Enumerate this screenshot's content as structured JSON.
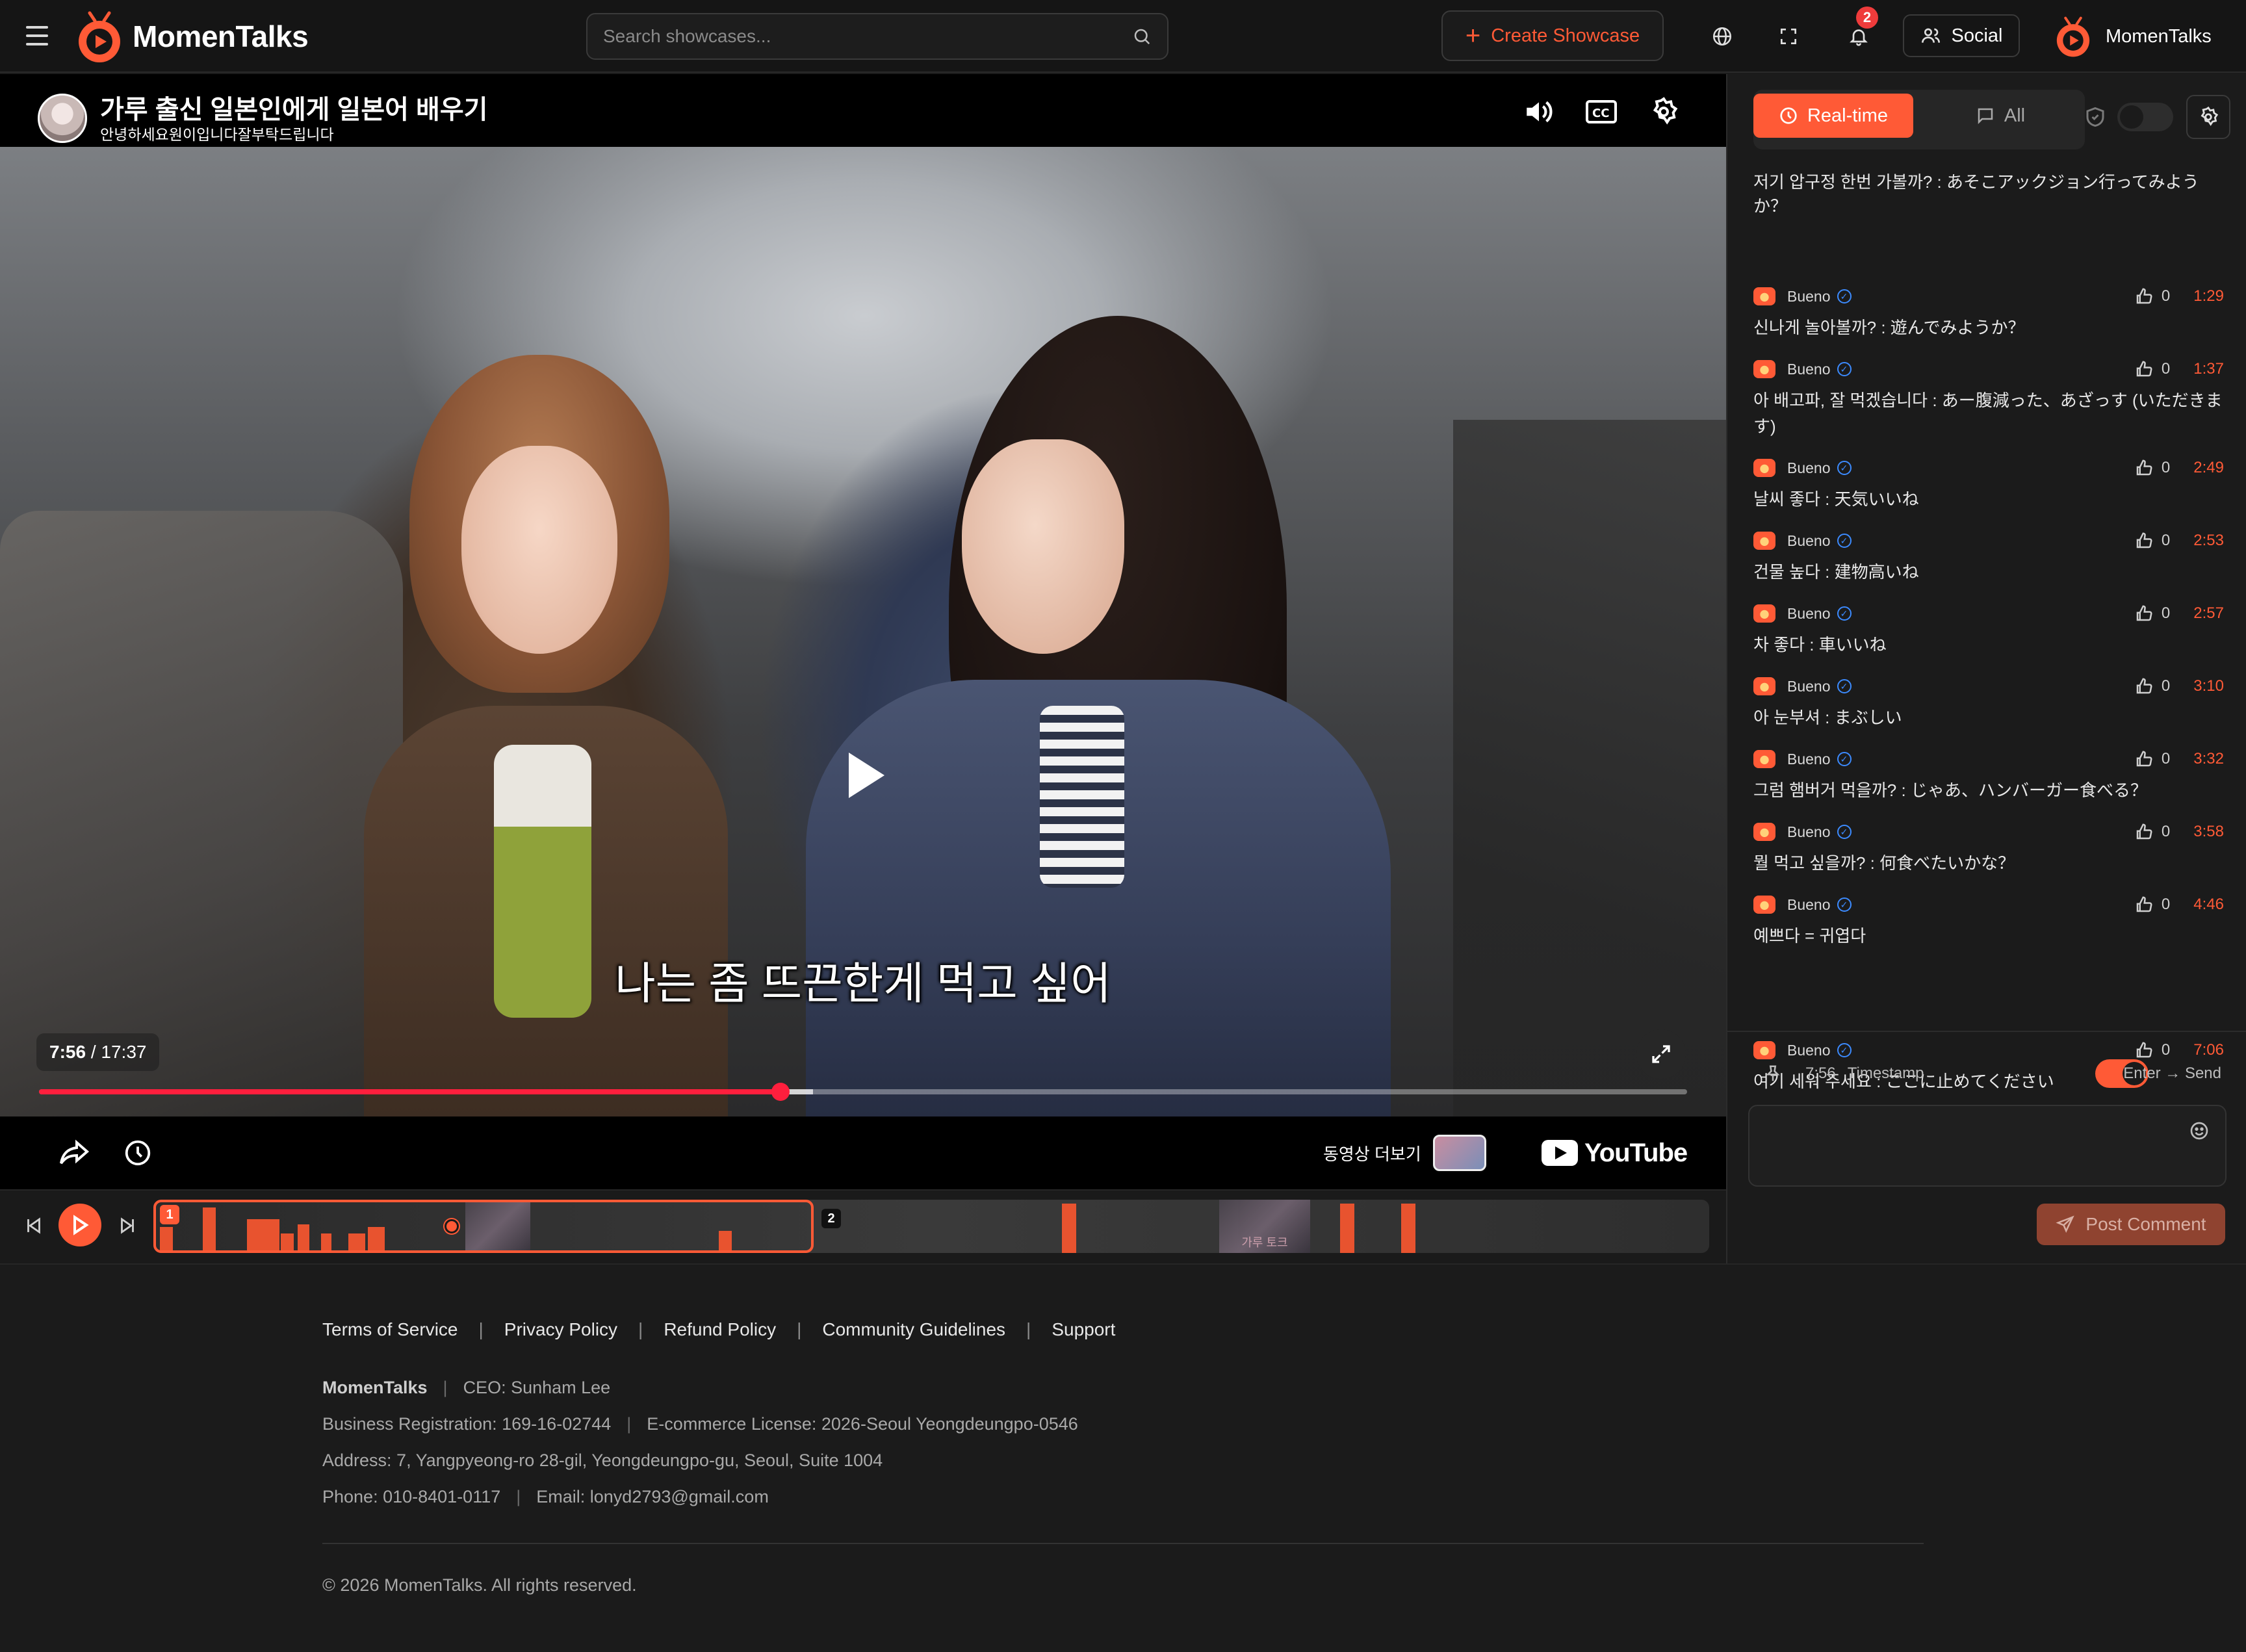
{
  "app": {
    "name": "MomenTalks",
    "brand_color": "#ff5a36"
  },
  "topbar": {
    "search_placeholder": "Search showcases...",
    "create_label": "Create Showcase",
    "notifications_count": "2",
    "social_label": "Social",
    "user_name": "MomenTalks"
  },
  "video": {
    "title": "가루 출신 일본인에게 일본어 배우기",
    "channel_subtitle": "안녕하세요원이입니다잘부탁드립니다",
    "caption": "나는 좀 뜨끈한게 먹고 싶어",
    "current_time": "7:56",
    "duration": "17:37",
    "progress_fraction": 0.45,
    "more_videos_label": "동영상 더보기",
    "youtube_label": "YouTube"
  },
  "timeline": {
    "segments": [
      "1",
      "2"
    ],
    "thumb_caption": "가루 토크"
  },
  "side": {
    "tab_realtime": "Real-time",
    "tab_all": "All",
    "top_partial_comment": "저기 압구정 한번 가볼까? : あそこアックジョン行ってみようか？",
    "comments": [
      {
        "user": "Bueno",
        "likes": "0",
        "time": "1:29",
        "text": "신나게 놀아볼까? : 遊んでみようか？"
      },
      {
        "user": "Bueno",
        "likes": "0",
        "time": "1:37",
        "text": "아 배고파, 잘 먹겠습니다 : あー腹減った、あざっす (いただきます)"
      },
      {
        "user": "Bueno",
        "likes": "0",
        "time": "2:49",
        "text": "날씨 좋다 : 天気いいね"
      },
      {
        "user": "Bueno",
        "likes": "0",
        "time": "2:53",
        "text": "건물 높다 : 建物高いね"
      },
      {
        "user": "Bueno",
        "likes": "0",
        "time": "2:57",
        "text": "차 좋다 : 車いいね"
      },
      {
        "user": "Bueno",
        "likes": "0",
        "time": "3:10",
        "text": "아 눈부셔 : まぶしい"
      },
      {
        "user": "Bueno",
        "likes": "0",
        "time": "3:32",
        "text": "그럼 햄버거 먹을까? : じゃあ、ハンバーガー食べる？"
      },
      {
        "user": "Bueno",
        "likes": "0",
        "time": "3:58",
        "text": "뭘 먹고 싶을까? : 何食べたいかな？"
      },
      {
        "user": "Bueno",
        "likes": "0",
        "time": "4:46",
        "text": "예쁘다 = 귀엽다"
      },
      {
        "user": "Bueno",
        "likes": "0",
        "time": "7:06",
        "text": "여기 세워 주세요 : ここに止めてください"
      }
    ],
    "timestamp_value": "7:56",
    "timestamp_label": "Timestamp",
    "send_hint": "Enter → Send",
    "post_label": "Post Comment"
  },
  "footer": {
    "links": [
      "Terms of Service",
      "Privacy Policy",
      "Refund Policy",
      "Community Guidelines",
      "Support"
    ],
    "company": "MomenTalks",
    "ceo": "CEO: Sunham Lee",
    "business_reg": "Business Registration: 169-16-02744",
    "ecommerce": "E-commerce License: 2026-Seoul Yeongdeungpo-0546",
    "address": "Address: 7, Yangpyeong-ro 28-gil, Yeongdeungpo-gu, Seoul, Suite 1004",
    "phone": "Phone: 010-8401-0117",
    "email": "Email: lonyd2793@gmail.com",
    "copyright": "© 2026 MomenTalks. All rights reserved."
  }
}
